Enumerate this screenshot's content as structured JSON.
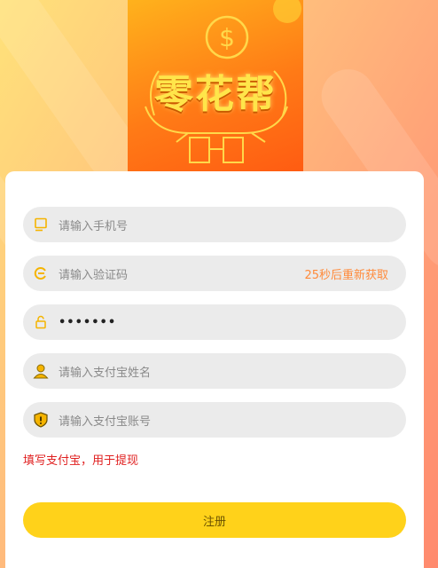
{
  "banner": {
    "title": "零花帮"
  },
  "form": {
    "phone_placeholder": "请输入手机号",
    "code_placeholder": "请输入验证码",
    "resend_label": "25秒后重新获取",
    "password_value": "•••••••",
    "alipay_name_placeholder": "请输入支付宝姓名",
    "alipay_account_placeholder": "请输入支付宝账号",
    "hint": "填写支付宝，用于提现",
    "register_label": "注册"
  },
  "colors": {
    "accent": "#ffd21a",
    "icon": "#f5b400",
    "resend": "#ff8a3a",
    "hint": "#e02020"
  }
}
